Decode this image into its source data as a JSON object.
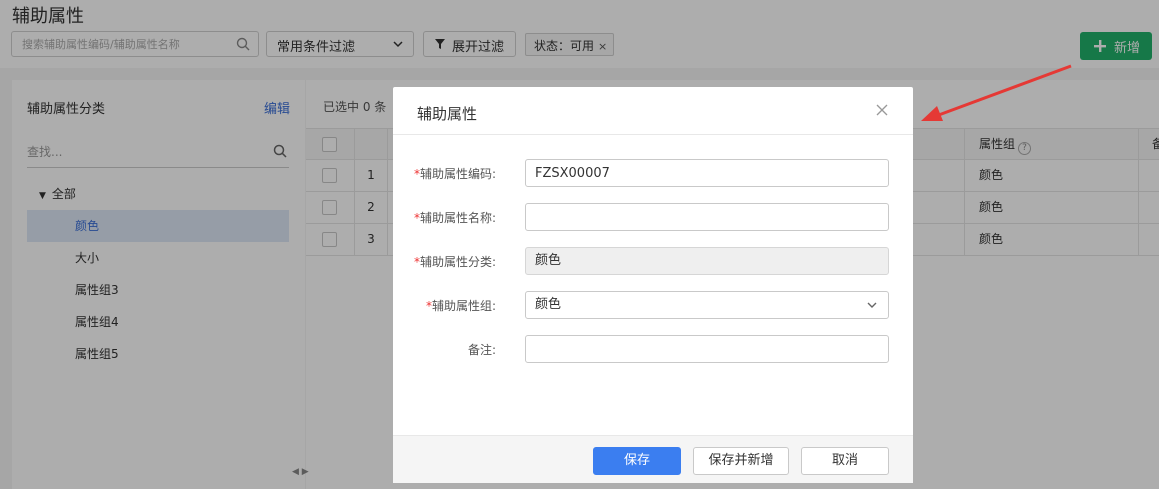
{
  "page": {
    "title": "辅助属性",
    "search_placeholder": "搜索辅助属性编码/辅助属性名称",
    "filter_select": "常用条件过滤",
    "expand_filter": "展开过滤",
    "status_tag": "状态：可用",
    "tag_close": "×",
    "add_button": "新增"
  },
  "sidebar": {
    "title": "辅助属性分类",
    "edit": "编辑",
    "search_placeholder": "查找...",
    "root": "全部",
    "items": [
      "颜色",
      "大小",
      "属性组3",
      "属性组4",
      "属性组5"
    ]
  },
  "table": {
    "selected_count": "已选中 0 条",
    "group_header": "属性组",
    "extra_header": "备",
    "rows": [
      {
        "index": "1",
        "group": "颜色"
      },
      {
        "index": "2",
        "group": "颜色"
      },
      {
        "index": "3",
        "group": "颜色"
      }
    ]
  },
  "dialog": {
    "title": "辅助属性",
    "code_label": "辅助属性编码:",
    "code_value": "FZSX00007",
    "name_label": "辅助属性名称:",
    "name_value": "",
    "category_label": "辅助属性分类:",
    "category_value": "颜色",
    "group_label": "辅助属性组:",
    "group_value": "颜色",
    "remark_label": "备注:",
    "remark_value": "",
    "save": "保存",
    "save_new": "保存并新增",
    "cancel": "取消"
  },
  "colors": {
    "accent": "#3b7ef0",
    "add_green": "#21b26a",
    "annotation_arrow": "#e53935"
  }
}
